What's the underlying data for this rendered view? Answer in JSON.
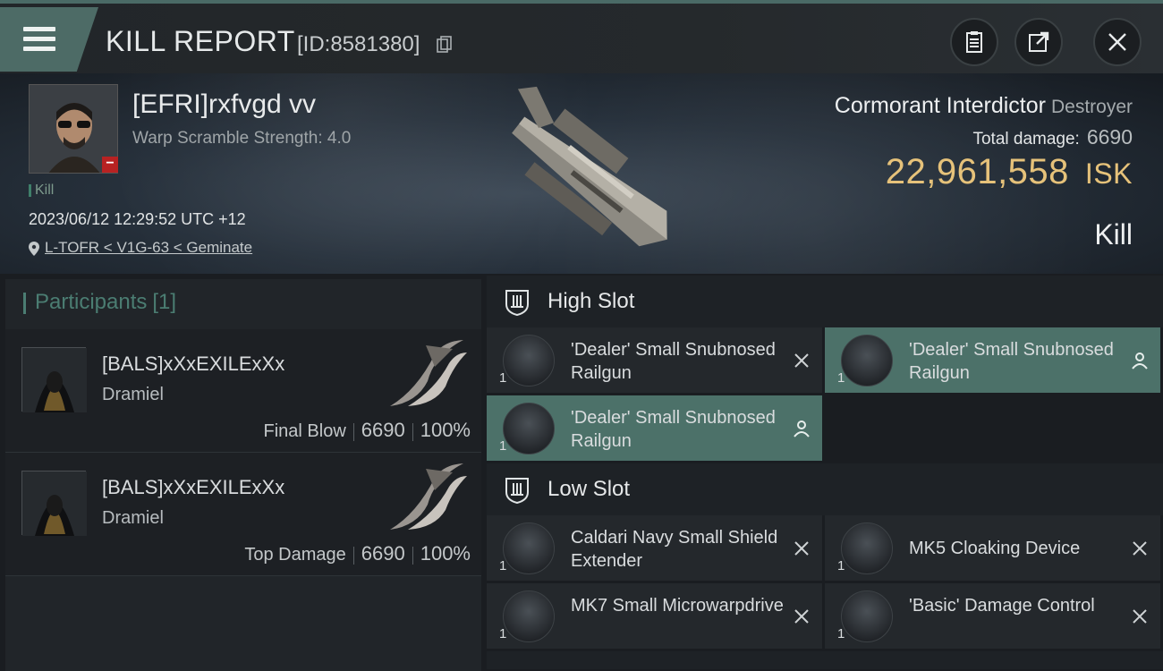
{
  "header": {
    "title": "KILL REPORT",
    "report_id": "[ID:8581380]"
  },
  "victim": {
    "name": "[EFRI]rxfvgd vv",
    "warp_scramble": "Warp Scramble Strength: 4.0",
    "tag": "Kill",
    "datetime": "2023/06/12 12:29:52 UTC +12",
    "location": "L-TOFR < V1G-63 < Geminate"
  },
  "ship": {
    "name": "Cormorant Interdictor",
    "class": "Destroyer",
    "total_damage_label": "Total damage:",
    "total_damage": "6690",
    "isk_value": "22,961,558",
    "isk_unit": "ISK",
    "result": "Kill"
  },
  "participants": {
    "title": "Participants",
    "count": "[1]",
    "rows": [
      {
        "name": "[BALS]xXxEXILExXx",
        "ship": "Dramiel",
        "label": "Final Blow",
        "damage": "6690",
        "percent": "100%"
      },
      {
        "name": "[BALS]xXxEXILExXx",
        "ship": "Dramiel",
        "label": "Top Damage",
        "damage": "6690",
        "percent": "100%"
      }
    ]
  },
  "fitting": {
    "high_slot": {
      "title": "High Slot",
      "modules": [
        {
          "qty": "1",
          "name": "'Dealer' Small Snubnosed Railgun",
          "state": "destroyed"
        },
        {
          "qty": "1",
          "name": "'Dealer' Small Snubnosed Railgun",
          "state": "dropped"
        },
        {
          "qty": "1",
          "name": "'Dealer' Small Snubnosed Railgun",
          "state": "dropped"
        }
      ]
    },
    "low_slot": {
      "title": "Low Slot",
      "modules": [
        {
          "qty": "1",
          "name": "Caldari Navy Small Shield Extender",
          "state": "destroyed"
        },
        {
          "qty": "1",
          "name": "MK5 Cloaking Device",
          "state": "destroyed"
        },
        {
          "qty": "1",
          "name": "MK7 Small Microwarpdrive",
          "state": "destroyed"
        },
        {
          "qty": "1",
          "name": "'Basic' Damage Control",
          "state": "destroyed"
        }
      ]
    }
  },
  "colors": {
    "accent": "#4c7169",
    "isk": "#e6c27a",
    "badge": "#b82222"
  },
  "icons": [
    "menu-icon",
    "copy-icon",
    "clipboard-icon",
    "share-icon",
    "close-icon",
    "location-pin-icon",
    "slot-shield-icon",
    "x-icon",
    "person-icon"
  ]
}
